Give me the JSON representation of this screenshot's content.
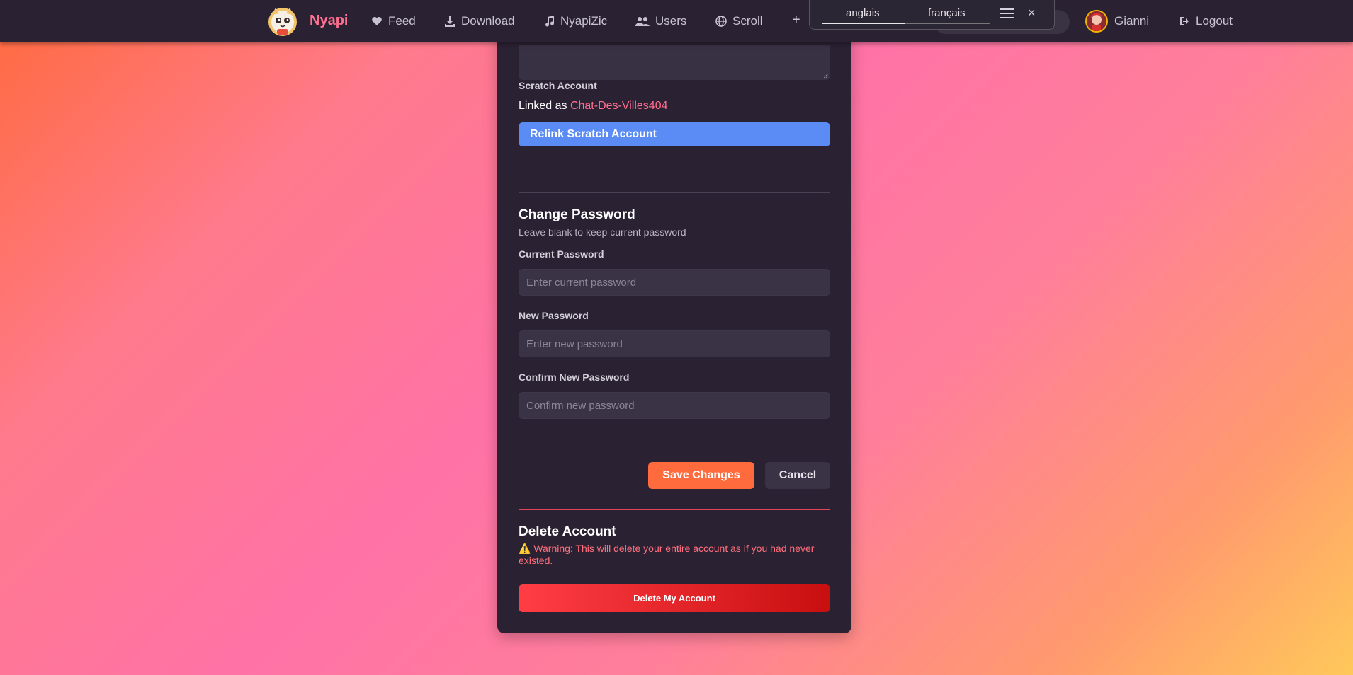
{
  "nav": {
    "brand": "Nyapi",
    "links": [
      {
        "label": "Feed",
        "icon": "heart-icon"
      },
      {
        "label": "Download",
        "icon": "download-icon"
      },
      {
        "label": "NyapiZic",
        "icon": "music-icon"
      },
      {
        "label": "Users",
        "icon": "users-icon"
      },
      {
        "label": "Scroll",
        "icon": "globe-icon"
      }
    ],
    "user_name": "Gianni",
    "logout_label": "Logout"
  },
  "translate_popup": {
    "source_lang": "anglais",
    "target_lang": "français",
    "close_glyph": "×"
  },
  "scratch": {
    "label": "Scratch Account",
    "linked_prefix": "Linked as ",
    "linked_user": "Chat-Des-Villes404",
    "relink_label": "Relink Scratch Account"
  },
  "password": {
    "title": "Change Password",
    "hint": "Leave blank to keep current password",
    "current_label": "Current Password",
    "current_placeholder": "Enter current password",
    "new_label": "New Password",
    "new_placeholder": "Enter new password",
    "confirm_label": "Confirm New Password",
    "confirm_placeholder": "Confirm new password"
  },
  "actions": {
    "save_label": "Save Changes",
    "cancel_label": "Cancel"
  },
  "delete": {
    "title": "Delete Account",
    "warning": "⚠️ Warning: This will delete your entire account as if you had never existed.",
    "button_label": "Delete My Account"
  },
  "colors": {
    "accent": "#ff6f8f",
    "primary_button": "#5b8bf5",
    "save_button": "#ff6b3d",
    "danger": "#e0455a",
    "card_bg": "#2a2233"
  }
}
